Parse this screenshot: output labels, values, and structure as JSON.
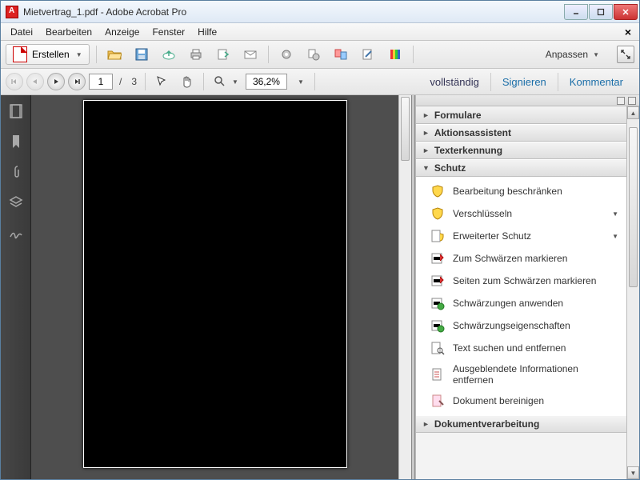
{
  "window": {
    "title": "Mietvertrag_1.pdf - Adobe Acrobat Pro"
  },
  "menu": {
    "items": [
      "Datei",
      "Bearbeiten",
      "Anzeige",
      "Fenster",
      "Hilfe"
    ]
  },
  "toolbar": {
    "create_label": "Erstellen",
    "customize_label": "Anpassen"
  },
  "nav": {
    "current_page": "1",
    "page_sep": "/",
    "total_pages": "3",
    "zoom": "36,2%"
  },
  "right_tabs": {
    "t1": "vollständig",
    "t2": "Signieren",
    "t3": "Kommentar"
  },
  "tools": {
    "sections": [
      {
        "label": "Formulare",
        "expanded": false,
        "cut": true
      },
      {
        "label": "Aktionsassistent",
        "expanded": false
      },
      {
        "label": "Texterkennung",
        "expanded": false
      },
      {
        "label": "Schutz",
        "expanded": true,
        "items": [
          {
            "label": "Bearbeitung beschränken",
            "icon": "shield-yellow"
          },
          {
            "label": "Verschlüsseln",
            "icon": "shield-yellow",
            "dropdown": true
          },
          {
            "label": "Erweiterter Schutz",
            "icon": "shield-doc",
            "dropdown": true
          },
          {
            "label": "Zum Schwärzen markieren",
            "icon": "redact-red"
          },
          {
            "label": "Seiten zum Schwärzen markieren",
            "icon": "redact-red"
          },
          {
            "label": "Schwärzungen anwenden",
            "icon": "redact-green"
          },
          {
            "label": "Schwärzungseigenschaften",
            "icon": "redact-green"
          },
          {
            "label": "Text suchen und entfernen",
            "icon": "search-doc"
          },
          {
            "label": "Ausgeblendete Informationen entfernen",
            "icon": "doc-clean"
          },
          {
            "label": "Dokument bereinigen",
            "icon": "doc-sweep"
          }
        ]
      },
      {
        "label": "Dokumentverarbeitung",
        "expanded": false
      }
    ]
  }
}
